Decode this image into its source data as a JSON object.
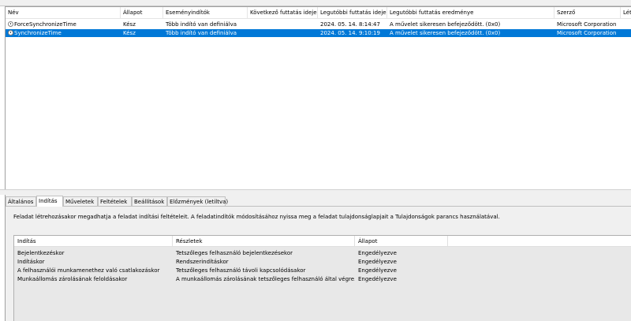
{
  "tasks": {
    "columns": [
      "Név",
      "Állapot",
      "Eseményindítók",
      "Következő futtatás ideje",
      "Legutóbbi futtatás ideje",
      "Legutóbbi futtatás eredménye",
      "Szerző",
      "Létr"
    ],
    "rows": [
      {
        "name": "ForceSynchronizeTime",
        "status": "Kész",
        "triggers": "Több indító van definiálva",
        "next_run": "",
        "last_run": "2024. 05. 14. 8:14:47",
        "result": "A művelet sikeresen befejeződött. (0x0)",
        "author": "Microsoft Corporation",
        "selected": false
      },
      {
        "name": "SynchronizeTime",
        "status": "Kész",
        "triggers": "Több indító van definiálva",
        "next_run": "",
        "last_run": "2024. 05. 14. 9:10:19",
        "result": "A művelet sikeresen befejeződött. (0x0)",
        "author": "Microsoft Corporation",
        "selected": true
      }
    ]
  },
  "detail": {
    "tabs": [
      "Általános",
      "Indítás",
      "Műveletek",
      "Feltételek",
      "Beállítások",
      "Előzmények (letiltva)"
    ],
    "active_tab": "Indítás",
    "description": "Feladat létrehozásakor megadhatja a feladat indítási feltételeit. A feladatindítók módosításához nyissa meg a feladat tulajdonságlapjait a Tulajdonságok parancs használatával.",
    "trigger_columns": [
      "Indítás",
      "Részletek",
      "Állapot"
    ],
    "triggers": [
      {
        "trigger": "Bejelentkezéskor",
        "details": "Tetszőleges felhasználó bejelentkezésekor",
        "status": "Engedélyezve"
      },
      {
        "trigger": "Indításkor",
        "details": "Rendszerindításkor",
        "status": "Engedélyezve"
      },
      {
        "trigger": "A felhasználói munkamenethez való csatlakozáskor",
        "details": "Tetszőleges felhasználó távoli kapcsolódásakor",
        "status": "Engedélyezve"
      },
      {
        "trigger": "Munkaállomás zárolásának feloldásakor",
        "details": "A munkaállomás zárolásának tetszőleges felhasználó által végre...",
        "status": "Engedélyezve"
      }
    ]
  },
  "colors": {
    "selection": "#0078d7",
    "pane_bg": "#f0f0f0"
  }
}
